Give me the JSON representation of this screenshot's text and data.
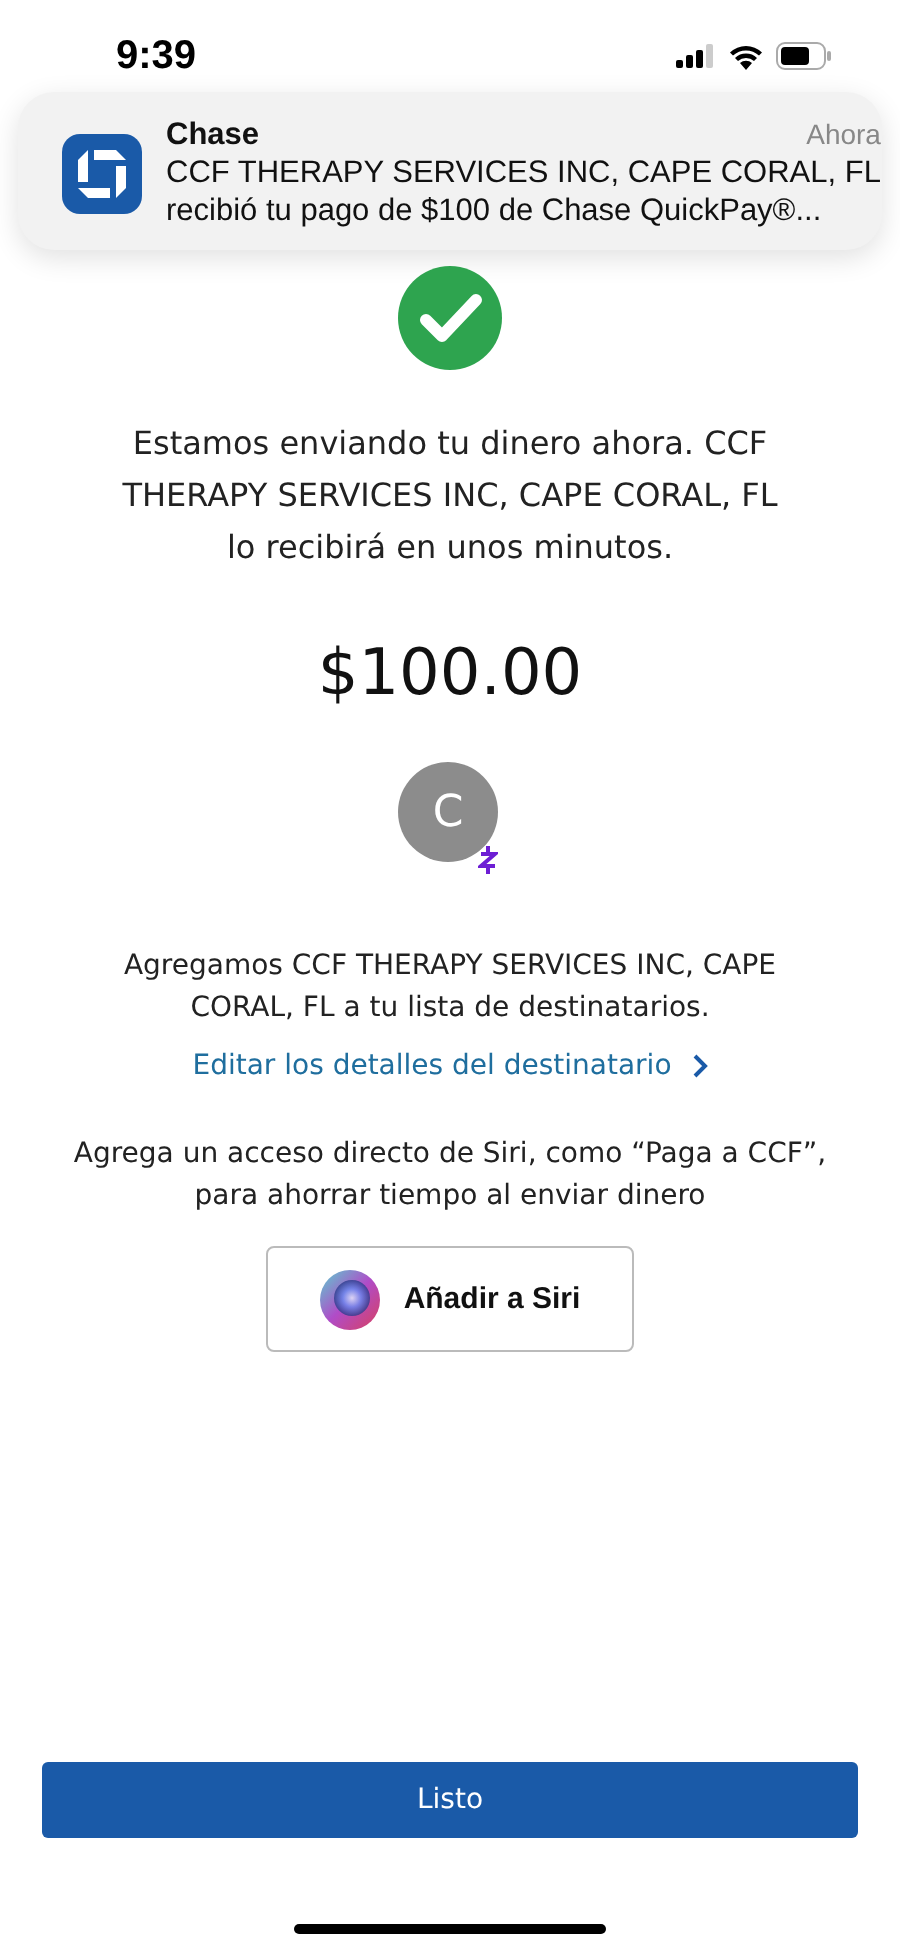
{
  "status_bar": {
    "time": "9:39"
  },
  "notification": {
    "app": "Chase",
    "time": "Ahora",
    "line_1": "CCF THERAPY SERVICES INC, CAPE CORAL, FL",
    "line_2": "recibió tu pago de $100 de Chase QuickPay®..."
  },
  "message": "Estamos enviando tu dinero ahora. CCF THERAPY SERVICES INC, CAPE CORAL, FL lo recibirá en unos minutos.",
  "amount": "$100.00",
  "recipient": {
    "initial": "C",
    "added_text": "Agregamos CCF THERAPY SERVICES INC, CAPE CORAL, FL a tu lista de destinatarios.",
    "edit_link": "Editar los detalles del destinatario"
  },
  "siri": {
    "text": "Agrega un acceso directo de Siri, como “Paga a CCF”, para ahorrar tiempo al enviar dinero",
    "button": "Añadir a Siri"
  },
  "done_button": "Listo"
}
